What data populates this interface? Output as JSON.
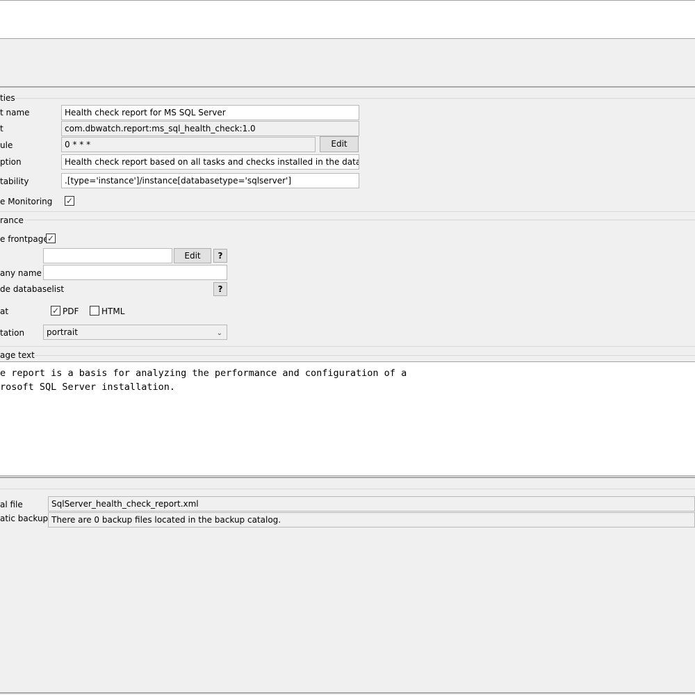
{
  "properties": {
    "section_label": "ties",
    "report_name": {
      "label": "t name",
      "value": "Health check report for MS SQL Server"
    },
    "report_id": {
      "label": "t",
      "value": "com.dbwatch.report:ms_sql_health_check:1.0"
    },
    "schedule": {
      "label": "ule",
      "value": "0 * * *",
      "edit_label": "Edit"
    },
    "description": {
      "label": "ption",
      "value": "Health check report based on all tasks and checks installed in the database eng"
    },
    "compatibility": {
      "label": "tability",
      "value": ".[type='instance']/instance[databasetype='sqlserver']"
    },
    "monitoring": {
      "label": "e Monitoring",
      "checked": "✓"
    }
  },
  "appearance": {
    "section_label": "rance",
    "frontpage": {
      "label": "e frontpage",
      "checked": "✓"
    },
    "logo_edit_label": "Edit",
    "help_label": "?",
    "company_name": {
      "label": "any name",
      "value": ""
    },
    "databaselist": {
      "label": "de databaselist"
    },
    "format": {
      "label": "at",
      "pdf_label": "PDF",
      "pdf_checked": "✓",
      "html_label": "HTML"
    },
    "orientation": {
      "label": "tation",
      "value": "portrait"
    }
  },
  "frontpage_text": {
    "section_label": "age text",
    "line1": "e report is a basis for analyzing the performance and configuration of a",
    "line2": "rosoft SQL Server installation."
  },
  "files": {
    "local_file": {
      "label": "al file",
      "value": "SqlServer_health_check_report.xml"
    },
    "backups": {
      "label": "atic backups",
      "value": "There are 0 backup files located in the backup catalog."
    }
  }
}
